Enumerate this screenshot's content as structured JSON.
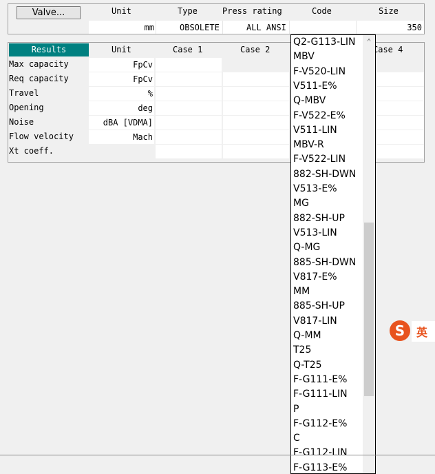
{
  "valve_panel": {
    "button_label": "Valve...",
    "headers": {
      "unit": "Unit",
      "type": "Type",
      "press_rating": "Press rating",
      "code": "Code",
      "size": "Size"
    },
    "values": {
      "unit": "mm",
      "type": "OBSOLETE",
      "press_rating": "ALL ANSI",
      "code": "",
      "size": "350"
    }
  },
  "results": {
    "header": "Results",
    "columns": {
      "unit": "Unit",
      "case1": "Case 1",
      "case2": "Case 2",
      "case4": "Case 4"
    },
    "rows": [
      {
        "label": "Max capacity",
        "unit": "FpCv"
      },
      {
        "label": "Req capacity",
        "unit": "FpCv"
      },
      {
        "label": "Travel",
        "unit": "%"
      },
      {
        "label": "Opening",
        "unit": "deg"
      },
      {
        "label": "Noise",
        "unit": "dBA [VDMA]"
      },
      {
        "label": "Flow velocity",
        "unit": "Mach"
      },
      {
        "label": "Xt coeff.",
        "unit": ""
      }
    ]
  },
  "dropdown": {
    "options": [
      "Q2-G113-LIN",
      "MBV",
      "F-V520-LIN",
      "V511-E%",
      "Q-MBV",
      "F-V522-E%",
      "V511-LIN",
      "MBV-R",
      "F-V522-LIN",
      "882-SH-DWN",
      "V513-E%",
      "MG",
      "882-SH-UP",
      "V513-LIN",
      "Q-MG",
      "885-SH-DWN",
      "V817-E%",
      "MM",
      "885-SH-UP",
      "V817-LIN",
      "Q-MM",
      "T25",
      "Q-T25",
      "F-G111-E%",
      "F-G111-LIN",
      "P",
      "F-G112-E%",
      "C",
      "F-G112-LIN",
      "F-G113-E%"
    ],
    "scroll_up_icon": "chevron-up-icon"
  },
  "ime": {
    "icon": "sogou-s-icon",
    "glyph": "S",
    "label": "英"
  }
}
